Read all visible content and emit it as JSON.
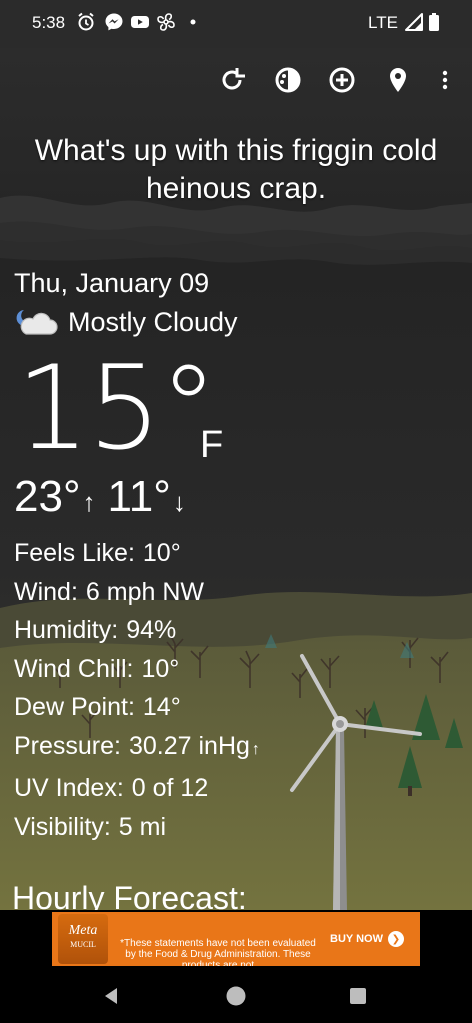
{
  "status_bar": {
    "time": "5:38",
    "network": "LTE",
    "icons": [
      "alarm-icon",
      "messenger-icon",
      "youtube-icon",
      "fan-icon",
      "dot-icon",
      "signal-icon",
      "battery-icon"
    ]
  },
  "toolbar": {
    "buttons": [
      "refresh-icon",
      "theme-icon",
      "add-icon",
      "location-icon",
      "more-icon"
    ]
  },
  "headline": "What's up with this friggin cold heinous crap.",
  "weather": {
    "date": "Thu, January 09",
    "condition": "Mostly Cloudy",
    "condition_icon": "partly-cloudy-night-icon",
    "temperature": "15°",
    "unit": "F",
    "high": "23°",
    "high_arrow": "↑",
    "low": "11°",
    "low_arrow": "↓"
  },
  "details": [
    {
      "label": "Feels Like:",
      "value": "10°"
    },
    {
      "label": "Wind:",
      "value": "6 mph NW"
    },
    {
      "label": "Humidity:",
      "value": "94%"
    },
    {
      "label": "Wind Chill:",
      "value": "10°"
    },
    {
      "label": "Dew Point:",
      "value": "14°"
    },
    {
      "label": "Pressure:",
      "value": "30.27 inHg",
      "trend": "↑"
    },
    {
      "label": "UV Index:",
      "value": "0 of 12"
    },
    {
      "label": "Visibility:",
      "value": "5 mi"
    }
  ],
  "hourly_title": "Hourly Forecast:",
  "ad": {
    "brand": "Meta",
    "brand_sub": "MUCIL",
    "disclaimer": "*These statements have not been evaluated by the Food & Drug Administration. These products are not",
    "cta": "BUY NOW",
    "accent": "#e97618"
  },
  "nav": {
    "buttons": [
      "back-icon",
      "home-icon",
      "recents-icon"
    ]
  },
  "colors": {
    "status_bar": "#2b2b2b",
    "sky": "#262626",
    "ground": "#6b6a3c",
    "text": "#ffffff"
  }
}
